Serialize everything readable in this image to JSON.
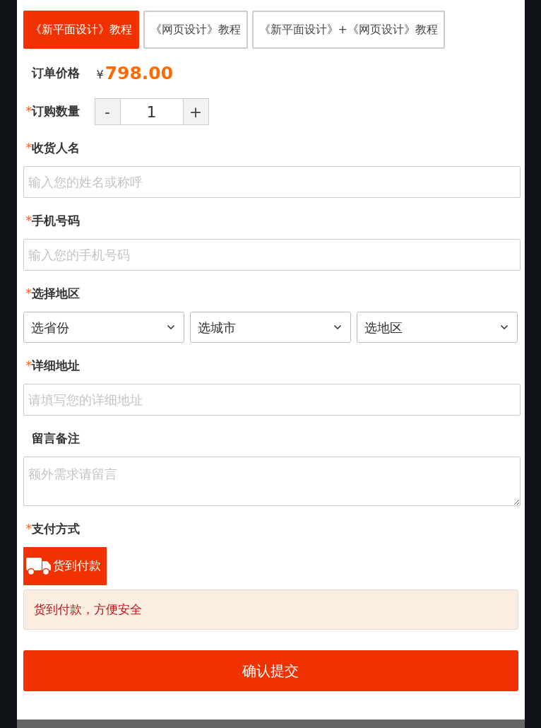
{
  "required_mark": "*",
  "tabs": [
    {
      "label": "《新平面设计》教程",
      "selected": true
    },
    {
      "label": "《网页设计》教程",
      "selected": false
    },
    {
      "label": "《新平面设计》+《网页设计》教程",
      "selected": false
    }
  ],
  "price": {
    "label": "订单价格",
    "currency": "¥",
    "amount": "798.00"
  },
  "quantity": {
    "label": "订购数量",
    "required": true,
    "minus": "-",
    "value": "1",
    "plus": "+"
  },
  "fields": [
    {
      "kind": "text",
      "label": "收货人名",
      "required": true,
      "placeholder": "输入您的姓名或称呼"
    },
    {
      "kind": "text",
      "label": "手机号码",
      "required": true,
      "placeholder": "输入您的手机号码"
    },
    {
      "kind": "selects",
      "label": "选择地区",
      "required": true,
      "options": [
        "选省份",
        "选城市",
        "选地区"
      ]
    },
    {
      "kind": "text",
      "label": "详细地址",
      "required": true,
      "placeholder": "请填写您的详细地址"
    },
    {
      "kind": "textarea",
      "label": "留言备注",
      "required": false,
      "placeholder": "额外需求请留言"
    }
  ],
  "payment": {
    "label": "支付方式",
    "required": true,
    "methods": [
      {
        "label": "货到付款",
        "selected": true
      }
    ],
    "notice": "货到付款，方便安全"
  },
  "submit": "确认提交"
}
